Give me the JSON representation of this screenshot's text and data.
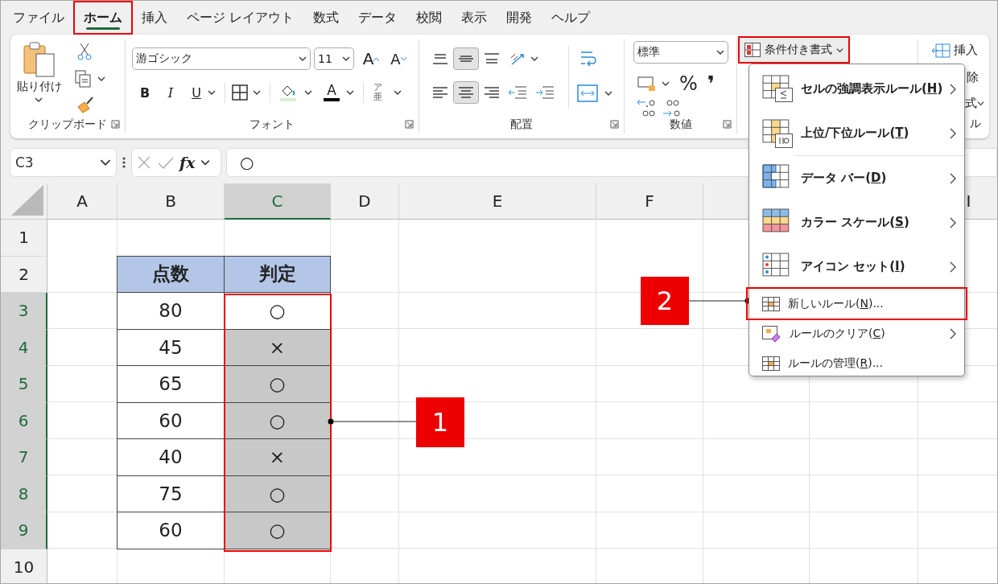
{
  "tabs": [
    {
      "label": "ファイル",
      "selected": false,
      "annotated": false
    },
    {
      "label": "ホーム",
      "selected": true,
      "annotated": true
    },
    {
      "label": "挿入",
      "selected": false,
      "annotated": false
    },
    {
      "label": "ページ レイアウト",
      "selected": false,
      "annotated": false
    },
    {
      "label": "数式",
      "selected": false,
      "annotated": false
    },
    {
      "label": "データ",
      "selected": false,
      "annotated": false
    },
    {
      "label": "校閲",
      "selected": false,
      "annotated": false
    },
    {
      "label": "表示",
      "selected": false,
      "annotated": false
    },
    {
      "label": "開発",
      "selected": false,
      "annotated": false
    },
    {
      "label": "ヘルプ",
      "selected": false,
      "annotated": false
    }
  ],
  "ribbon": {
    "clipboard": {
      "paste_label": "貼り付け",
      "group_label": "クリップボード"
    },
    "font": {
      "font_name": "游ゴシック",
      "font_size": "11",
      "grow": "A",
      "shrink": "A",
      "bold": "B",
      "italic": "I",
      "underline": "U",
      "font_color": "A",
      "phonetic_top": "ア",
      "phonetic_bottom": "亜",
      "group_label": "フォント"
    },
    "alignment": {
      "vertical": [
        {
          "selected": false
        },
        {
          "selected": true
        },
        {
          "selected": false
        }
      ],
      "horizontal": [
        {
          "selected": false
        },
        {
          "selected": true
        },
        {
          "selected": false
        }
      ],
      "group_label": "配置"
    },
    "number": {
      "format": "標準",
      "percent": "%",
      "comma": "❜",
      "group_label": "数値"
    },
    "styles": {
      "conditional_formatting": "条件付き書式",
      "annotated": true
    },
    "cells": {
      "insert": "挿入",
      "delete_visible": "除",
      "format_visible": "式",
      "group_label_visible": "ル"
    }
  },
  "formula_bar": {
    "name_box": "C3",
    "fx": "fx",
    "formula": "○"
  },
  "sheet": {
    "columns": [
      {
        "label": "A",
        "selected": false
      },
      {
        "label": "B",
        "selected": false
      },
      {
        "label": "C",
        "selected": true
      },
      {
        "label": "D",
        "selected": false
      },
      {
        "label": "E",
        "selected": false
      },
      {
        "label": "F",
        "selected": false
      },
      {
        "label": "I",
        "selected": false
      }
    ],
    "rows": [
      {
        "label": "1",
        "selected": false
      },
      {
        "label": "2",
        "selected": false
      },
      {
        "label": "3",
        "selected": true
      },
      {
        "label": "4",
        "selected": true
      },
      {
        "label": "5",
        "selected": true
      },
      {
        "label": "6",
        "selected": true
      },
      {
        "label": "7",
        "selected": true
      },
      {
        "label": "8",
        "selected": true
      },
      {
        "label": "9",
        "selected": true
      },
      {
        "label": "10",
        "selected": false
      }
    ],
    "table": {
      "header": [
        "点数",
        "判定"
      ],
      "rows": [
        {
          "score": "80",
          "result": "○",
          "active": true
        },
        {
          "score": "45",
          "result": "×",
          "active": false
        },
        {
          "score": "65",
          "result": "○",
          "active": false
        },
        {
          "score": "60",
          "result": "○",
          "active": false
        },
        {
          "score": "40",
          "result": "×",
          "active": false
        },
        {
          "score": "75",
          "result": "○",
          "active": false
        },
        {
          "score": "60",
          "result": "○",
          "active": false
        }
      ]
    }
  },
  "menu": {
    "items": [
      {
        "kind": "large",
        "label": "セルの強調表示ルール(",
        "key": "H",
        "end": ")",
        "submenu": true,
        "annotated": false,
        "divider_before": false
      },
      {
        "kind": "large",
        "label": "上位/下位ルール(",
        "key": "T",
        "end": ")",
        "submenu": true,
        "annotated": false,
        "divider_before": false
      },
      {
        "kind": "large",
        "label": "データ バー(",
        "key": "D",
        "end": ")",
        "submenu": true,
        "annotated": false,
        "divider_before": true
      },
      {
        "kind": "large",
        "label": "カラー スケール(",
        "key": "S",
        "end": ")",
        "submenu": true,
        "annotated": false,
        "divider_before": false
      },
      {
        "kind": "large",
        "label": "アイコン セット(",
        "key": "I",
        "end": ")",
        "submenu": true,
        "annotated": false,
        "divider_before": false
      },
      {
        "kind": "small",
        "label": "新しいルール(",
        "key": "N",
        "end": ")...",
        "submenu": false,
        "annotated": true,
        "divider_before": false
      },
      {
        "kind": "small",
        "label": "ルールのクリア(",
        "key": "C",
        "end": ")",
        "submenu": true,
        "annotated": false,
        "divider_before": false
      },
      {
        "kind": "small",
        "label": "ルールの管理(",
        "key": "R",
        "end": ")...",
        "submenu": false,
        "annotated": false,
        "divider_before": false
      }
    ]
  },
  "callouts": [
    {
      "label": "1"
    },
    {
      "label": "2"
    }
  ]
}
